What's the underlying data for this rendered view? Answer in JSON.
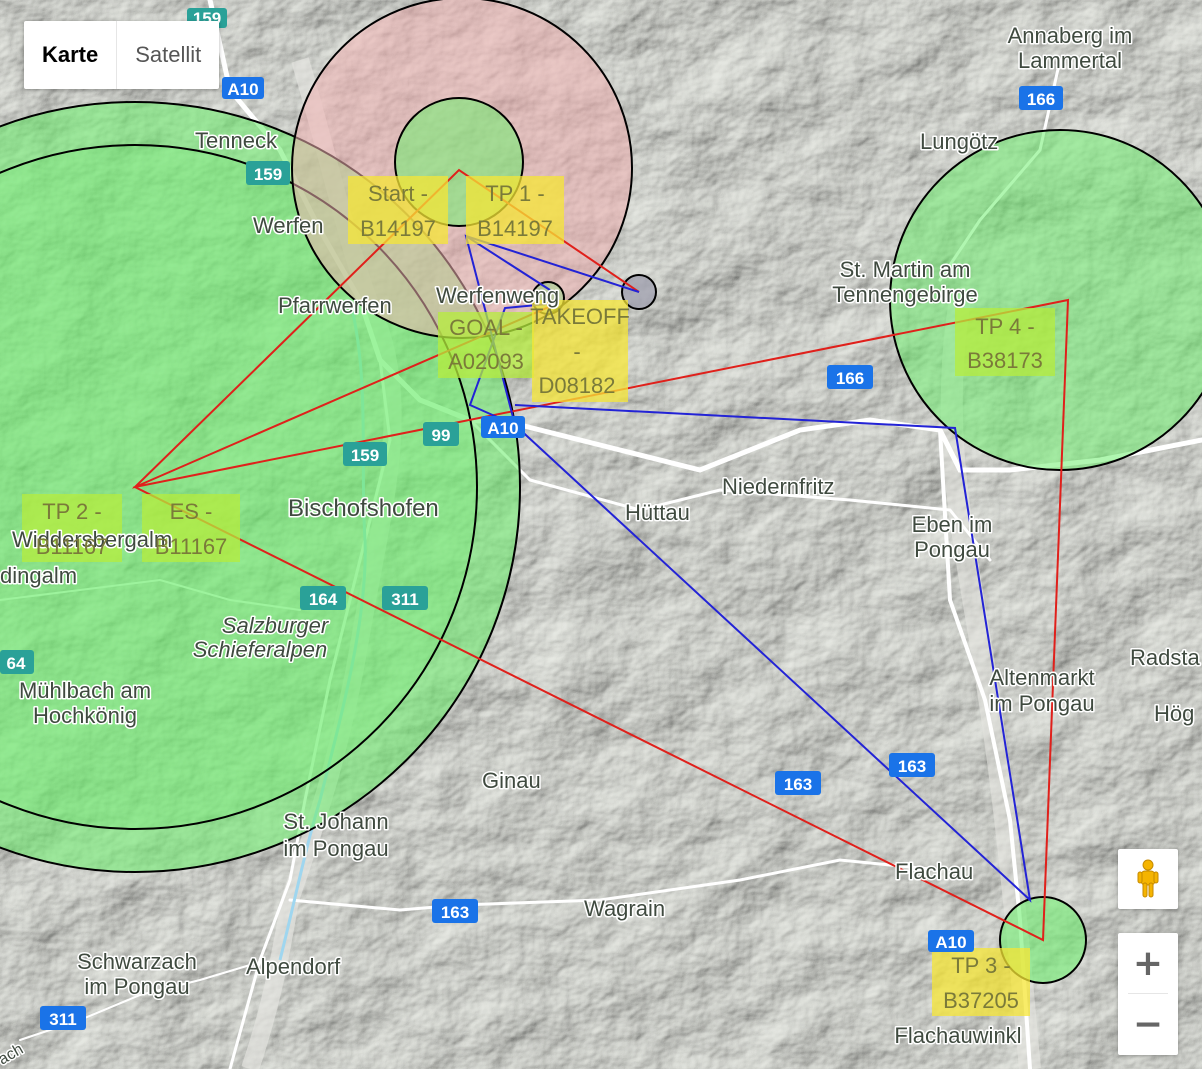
{
  "map_type": {
    "options": [
      "Karte",
      "Satellit"
    ],
    "selected": "Karte"
  },
  "places": [
    {
      "name": "Annaberg im",
      "size": 22
    },
    {
      "name": "Lammertal",
      "size": 22
    },
    {
      "name": "Tenneck",
      "size": 22
    },
    {
      "name": "Lungötz",
      "size": 22
    },
    {
      "name": "Werfen",
      "size": 22
    },
    {
      "name": "St. Martin am",
      "size": 22
    },
    {
      "name": "Tennengebirge",
      "size": 22
    },
    {
      "name": "Pfarrwerfen",
      "size": 22
    },
    {
      "name": "Werfenweng",
      "size": 22
    },
    {
      "name": "Bischofshofen",
      "size": 24
    },
    {
      "name": "Niedernfritz",
      "size": 22
    },
    {
      "name": "Hüttau",
      "size": 22
    },
    {
      "name": "Eben im",
      "size": 22
    },
    {
      "name": "Pongau",
      "size": 22
    },
    {
      "name": "Widdersbergalm",
      "size": 22
    },
    {
      "name": "dingalm",
      "size": 22
    },
    {
      "name": "Salzburger",
      "size": 22
    },
    {
      "name": "Schieferalpen",
      "size": 22
    },
    {
      "name": "Mühlbach am",
      "size": 22
    },
    {
      "name": "Hochkönig",
      "size": 22
    },
    {
      "name": "Radsta",
      "size": 22
    },
    {
      "name": "Altenmarkt",
      "size": 22
    },
    {
      "name": "im Pongau",
      "size": 22
    },
    {
      "name": "Hög",
      "size": 22
    },
    {
      "name": "Ginau",
      "size": 22
    },
    {
      "name": "St. Johann",
      "size": 22
    },
    {
      "name": "im Pongau",
      "size": 22
    },
    {
      "name": "Flachau",
      "size": 22
    },
    {
      "name": "Wagrain",
      "size": 22
    },
    {
      "name": "Schwarzach",
      "size": 22
    },
    {
      "name": "im Pongau",
      "size": 22
    },
    {
      "name": "Alpendorf",
      "size": 22
    },
    {
      "name": "Flachauwinkl",
      "size": 22
    },
    {
      "name": "ach",
      "size": 16
    }
  ],
  "road_shields": [
    {
      "label": "159",
      "color": "#2aa198"
    },
    {
      "label": "A10",
      "color": "#1a73e8"
    },
    {
      "label": "166",
      "color": "#1a73e8"
    },
    {
      "label": "159",
      "color": "#2aa198"
    },
    {
      "label": "166",
      "color": "#1a73e8"
    },
    {
      "label": "99",
      "color": "#2aa198"
    },
    {
      "label": "A10",
      "color": "#1a73e8"
    },
    {
      "label": "159",
      "color": "#2aa198"
    },
    {
      "label": "164",
      "color": "#2aa198"
    },
    {
      "label": "311",
      "color": "#2aa198"
    },
    {
      "label": "64",
      "color": "#2aa198"
    },
    {
      "label": "163",
      "color": "#1a73e8"
    },
    {
      "label": "163",
      "color": "#1a73e8"
    },
    {
      "label": "163",
      "color": "#1a73e8"
    },
    {
      "label": "A10",
      "color": "#1a73e8"
    },
    {
      "label": "311",
      "color": "#1a73e8"
    }
  ],
  "waypoints": [
    {
      "lines": [
        "Start -",
        "B14197"
      ]
    },
    {
      "lines": [
        "TP 1 -",
        "B14197"
      ]
    },
    {
      "lines": [
        "GOAL -",
        "A02093"
      ]
    },
    {
      "lines": [
        "TAKEOFF",
        "-",
        "D08182"
      ]
    },
    {
      "lines": [
        "TP 4 -",
        "B38173"
      ]
    },
    {
      "lines": [
        "TP 2 -",
        "B11167"
      ]
    },
    {
      "lines": [
        "ES -",
        "B11167"
      ]
    },
    {
      "lines": [
        "TP 3 -",
        "B37205"
      ]
    }
  ],
  "colors": {
    "route_red": "#e0201b",
    "route_blue": "#2323d6",
    "cylinder_green": "#6fee6f",
    "cylinder_pink": "#f0b0b0",
    "label_yellow": "#f6e636",
    "label_green": "#b6ec3c"
  },
  "controls": {
    "pegman": "pegman-icon",
    "zoom_in": "+",
    "zoom_out": "−"
  }
}
